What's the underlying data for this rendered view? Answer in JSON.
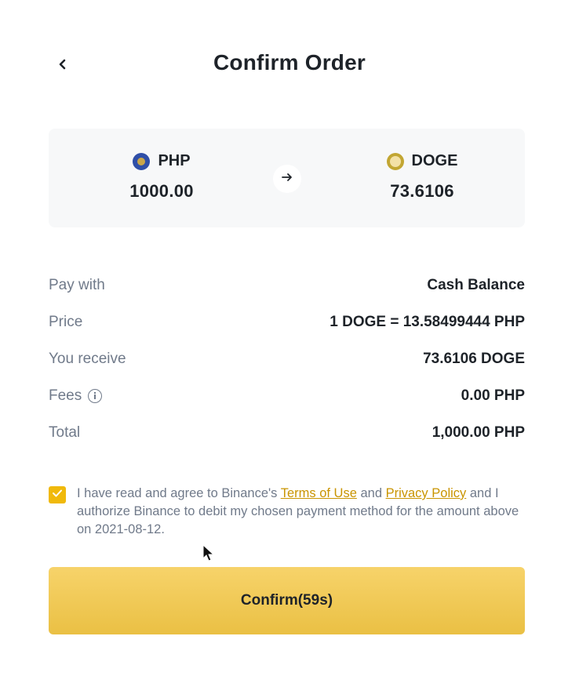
{
  "header": {
    "title": "Confirm Order",
    "back_icon": "chevron-left-icon"
  },
  "conversion": {
    "from": {
      "currency": "PHP",
      "amount": "1000.00",
      "icon": "php-coin-icon",
      "color": "#2f4fa8"
    },
    "to": {
      "currency": "DOGE",
      "amount": "73.6106",
      "icon": "doge-coin-icon",
      "color": "#c2a633"
    },
    "arrow_icon": "arrow-right-icon"
  },
  "details": [
    {
      "label": "Pay with",
      "value": "Cash Balance"
    },
    {
      "label": "Price",
      "value": "1 DOGE = 13.58499444 PHP"
    },
    {
      "label": "You receive",
      "value": "73.6106 DOGE"
    },
    {
      "label": "Fees",
      "value": "0.00 PHP",
      "icon": "info-icon"
    },
    {
      "label": "Total",
      "value": "1,000.00 PHP"
    }
  ],
  "agreement": {
    "checked": true,
    "text_before": "I have read and agree to Binance's ",
    "terms_link": "Terms of Use",
    "text_middle": " and ",
    "privacy_link": "Privacy Policy",
    "text_after": " and I authorize Binance to debit my chosen payment method for the amount above on 2021-08-12."
  },
  "confirm_button": {
    "label": "Confirm(59s)"
  },
  "colors": {
    "accent": "#f0b90b",
    "link": "#c99400",
    "text_primary": "#1e2329",
    "text_secondary": "#707a8a",
    "card_bg": "#f7f8f9"
  }
}
